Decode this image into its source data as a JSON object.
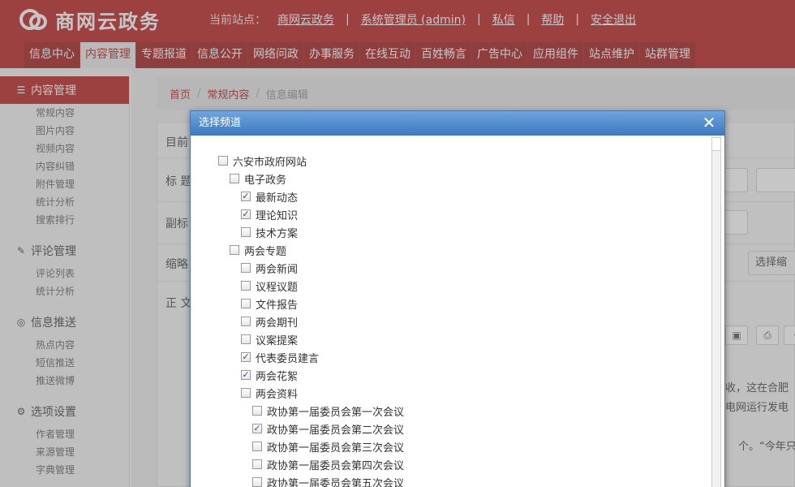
{
  "header": {
    "logo_text": "商网云政务",
    "current_site_label": "当前站点：",
    "links": [
      "商网云政务",
      "系统管理员 (admin)",
      "私信",
      "帮助",
      "安全退出"
    ],
    "nav": [
      "信息中心",
      "内容管理",
      "专题报道",
      "信息公开",
      "网络问政",
      "办事服务",
      "在线互动",
      "百姓畅言",
      "广告中心",
      "应用组件",
      "站点维护",
      "站群管理"
    ]
  },
  "sidebar": {
    "groups": [
      {
        "title": "内容管理",
        "icon": "menu-icon",
        "items": [
          "常规内容",
          "图片内容",
          "视频内容",
          "内容纠错",
          "附件管理",
          "统计分析",
          "搜索排行"
        ]
      },
      {
        "title": "评论管理",
        "icon": "pencil-icon",
        "items": [
          "评论列表",
          "统计分析"
        ]
      },
      {
        "title": "信息推送",
        "icon": "circle-check-icon",
        "items": [
          "热点内容",
          "短信推送",
          "推送微博"
        ]
      },
      {
        "title": "选项设置",
        "icon": "gear-icon",
        "items": [
          "作者管理",
          "来源管理",
          "字典管理"
        ]
      }
    ]
  },
  "breadcrumb": [
    "首页",
    "常规内容",
    "信息编辑"
  ],
  "form": {
    "labels": [
      "目前",
      "标 题",
      "副标",
      "缩略",
      "正 文"
    ],
    "select_thumb_btn": "选择缩",
    "para_lines": [
      "收，这在合肥",
      "电网运行发电",
      "个。“今年只"
    ]
  },
  "modal": {
    "title": "选择频道",
    "close_label": "✕",
    "tree": [
      {
        "label": "六安市政府网站",
        "level": 0,
        "checked": false
      },
      {
        "label": "电子政务",
        "level": 1,
        "checked": false
      },
      {
        "label": "最新动态",
        "level": 2,
        "checked": true
      },
      {
        "label": "理论知识",
        "level": 2,
        "checked": true
      },
      {
        "label": "技术方案",
        "level": 2,
        "checked": false
      },
      {
        "label": "两会专题",
        "level": 1,
        "checked": false
      },
      {
        "label": "两会新闻",
        "level": 2,
        "checked": false
      },
      {
        "label": "议程议题",
        "level": 2,
        "checked": false
      },
      {
        "label": "文件报告",
        "level": 2,
        "checked": false
      },
      {
        "label": "两会期刊",
        "level": 2,
        "checked": false
      },
      {
        "label": "议案提案",
        "level": 2,
        "checked": false
      },
      {
        "label": "代表委员建言",
        "level": 2,
        "checked": true
      },
      {
        "label": "两会花絮",
        "level": 2,
        "checked": true
      },
      {
        "label": "两会资料",
        "level": 2,
        "checked": false
      },
      {
        "label": "政协第一届委员会第一次会议",
        "level": 3,
        "checked": false
      },
      {
        "label": "政协第一届委员会第二次会议",
        "level": 3,
        "checked": true
      },
      {
        "label": "政协第一届委员会第三次会议",
        "level": 3,
        "checked": false
      },
      {
        "label": "政协第一届委员会第四次会议",
        "level": 3,
        "checked": false
      },
      {
        "label": "政协第一届委员会第五次会议",
        "level": 3,
        "checked": false
      }
    ]
  }
}
